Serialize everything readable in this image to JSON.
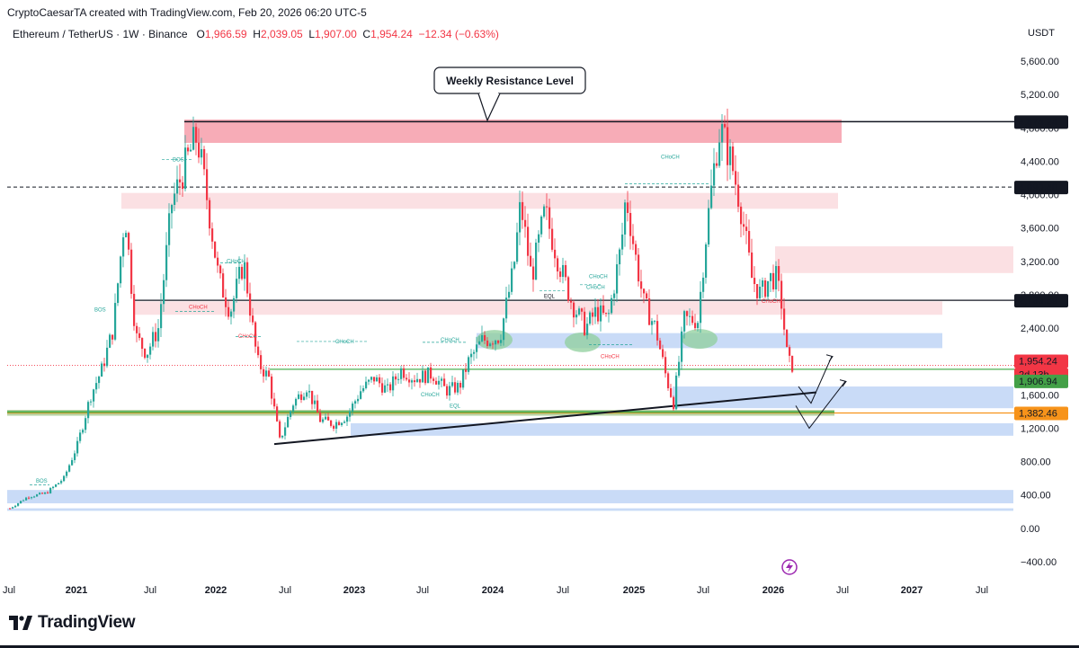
{
  "header": {
    "credit": "CryptoCaesarTA created with TradingView.com, Feb 20, 2026 06:20 UTC-5",
    "symbol": "Ethereum / TetherUS · 1W · Binance",
    "ohlc": {
      "o_label": "O",
      "o_value": "1,966.59",
      "h_label": "H",
      "h_value": "2,039.05",
      "l_label": "L",
      "l_value": "1,907.00",
      "c_label": "C",
      "c_value": "1,954.24",
      "change": "−12.34 (−0.63%)"
    },
    "currency": "USDT"
  },
  "colors": {
    "up": "#26a69a",
    "down": "#f23645",
    "resistance_zone": "#f7a8b3",
    "light_red_zone": "#fbe0e3",
    "blue_zone": "#c9dbf7",
    "green_line": "#4caf50",
    "orange_line": "#f7931a"
  },
  "chart_data": {
    "type": "candlestick",
    "title": "",
    "ylim": [
      -400,
      5900
    ],
    "y_ticks": [
      "5,600.00",
      "5,200.00",
      "4,800.00",
      "4,400.00",
      "4,000.00",
      "3,600.00",
      "3,200.00",
      "2,800.00",
      "2,400.00",
      "2,000.00",
      "1,600.00",
      "1,200.00",
      "800.00",
      "400.00",
      "0.00",
      "−400.00"
    ],
    "x_ticks": [
      {
        "label": "Jul",
        "bold": false
      },
      {
        "label": "2021",
        "bold": true
      },
      {
        "label": "Jul",
        "bold": false
      },
      {
        "label": "2022",
        "bold": true
      },
      {
        "label": "Jul",
        "bold": false
      },
      {
        "label": "2023",
        "bold": true
      },
      {
        "label": "Jul",
        "bold": false
      },
      {
        "label": "2024",
        "bold": true
      },
      {
        "label": "Jul",
        "bold": false
      },
      {
        "label": "2025",
        "bold": true
      },
      {
        "label": "Jul",
        "bold": false
      },
      {
        "label": "2026",
        "bold": true
      },
      {
        "label": "Jul",
        "bold": false
      },
      {
        "label": "2027",
        "bold": true
      },
      {
        "label": "Jul",
        "bold": false
      }
    ],
    "price_labels": [
      {
        "value": "4,874.24",
        "style": "dark"
      },
      {
        "value": "4,090.40",
        "style": "dark"
      },
      {
        "value": "2,733.59",
        "style": "dark"
      },
      {
        "value": "1,954.24",
        "style": "red"
      },
      {
        "value": "2d 13h",
        "style": "red"
      },
      {
        "value": "1,906.94",
        "style": "green"
      },
      {
        "value": "1,382.46",
        "style": "orange"
      }
    ],
    "annotation": "Weekly Resistance Level",
    "structure_labels": [
      "BOS",
      "BOS",
      "BOS",
      "CHoCH",
      "CHoCH",
      "CHoCH",
      "CHoCH",
      "CHoCH",
      "CHoCH",
      "CHoCH",
      "CHoCH",
      "CHoCH",
      "CHoCH",
      "CHoCH",
      "EQL",
      "EQL"
    ],
    "key_levels": [
      4874.24,
      4090.4,
      2733.59,
      1906.94,
      1382.46
    ]
  },
  "footer": {
    "brand": "TradingView"
  }
}
